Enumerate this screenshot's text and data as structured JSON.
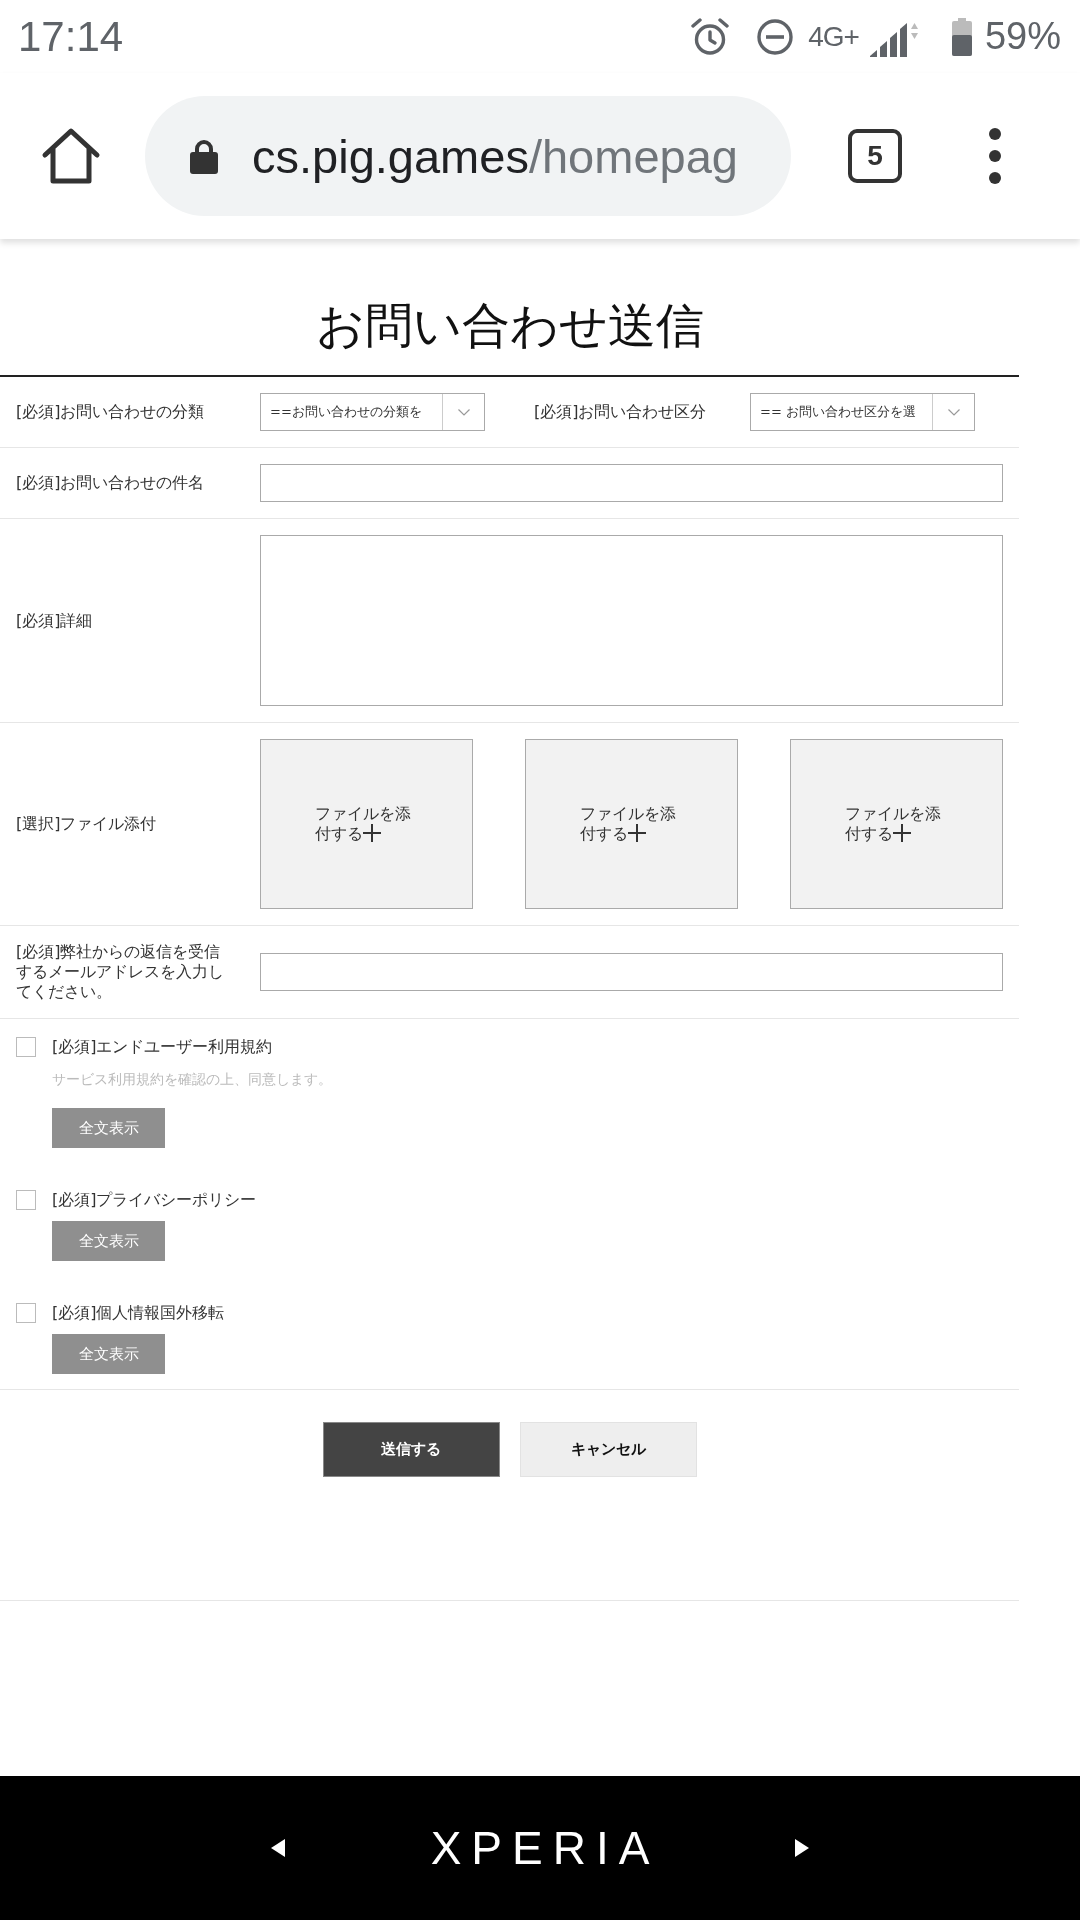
{
  "status_bar": {
    "time": "17:14",
    "network": "4G+",
    "battery": "59%"
  },
  "browser": {
    "url_host": "cs.pig.games",
    "url_path": "/homepag",
    "tab_count": "5"
  },
  "title": "お問い合わせ送信",
  "form_rows": [
    {
      "kind": "selects",
      "fields": [
        {
          "label": "[必須]お問い合わせの分類",
          "value": "==お問い合わせの分類を"
        },
        {
          "label": "[必須]お問い合わせ区分",
          "value": "== お問い合わせ区分を選"
        }
      ]
    },
    {
      "kind": "text",
      "label": "[必須]お問い合わせの件名"
    },
    {
      "kind": "textarea",
      "label": "[必須]詳細"
    },
    {
      "kind": "files",
      "label": "[選択]ファイル添付",
      "slots": [
        {
          "label": "ファイルを添付する"
        },
        {
          "label": "ファイルを添付する"
        },
        {
          "label": "ファイルを添付する"
        }
      ]
    },
    {
      "kind": "text",
      "label": "[必須]弊社からの返信を受信するメールアドレスを入力してください。"
    }
  ],
  "agreements": [
    {
      "label": "[必須]エンドユーザー利用規約",
      "note": "サービス利用規約を確認の上、同意します。",
      "checked": false,
      "button": "全文表示"
    },
    {
      "label": "[必須]プライバシーポリシー",
      "checked": false,
      "button": "全文表示"
    },
    {
      "label": "[必須]個人情報国外移転",
      "checked": false,
      "button": "全文表示"
    }
  ],
  "actions": [
    {
      "kind": "primary",
      "label": "送信する"
    },
    {
      "kind": "secondary",
      "label": "キャンセル"
    }
  ],
  "nav_bar": {
    "brand": "XPERIA"
  }
}
